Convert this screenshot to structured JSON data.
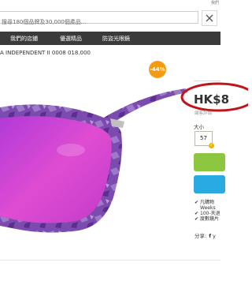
{
  "header": {
    "top_link": "我們",
    "search_value": "搜尋180個品牌及30,000個產品..."
  },
  "nav": {
    "items": [
      "我們的店鋪",
      "優選精品",
      "防盜光眼鏡"
    ]
  },
  "product": {
    "id_line": "A INDEPENDENT II 0008 018.000",
    "discount": "-44%",
    "price": "HK$8",
    "reviews_text": "顧客評價",
    "size_label": "大小",
    "size_value": "57",
    "features": [
      "凡購物",
      "Weeks",
      "100-天退",
      "度數鏡片"
    ],
    "share_label": "分享:",
    "share_fb": "f",
    "share_tw": "y"
  },
  "colors": {
    "nav_bg": "#3a3a3a",
    "discount": "#f39c12",
    "annotation_ring": "#c0141a",
    "green_button": "#8dc63f",
    "blue_button": "#29abe2",
    "frame_purple": "#7c4bb0",
    "lens_pink": "#d63bd0"
  },
  "icons": {
    "close": "close-icon",
    "check": "check-icon",
    "facebook": "facebook-icon",
    "twitter": "twitter-icon"
  }
}
